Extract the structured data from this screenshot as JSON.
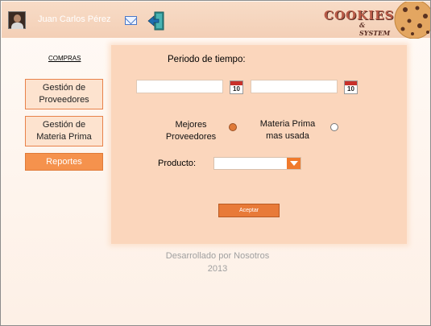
{
  "header": {
    "user_name": "Juan Carlos Pérez",
    "mail_icon": "mail-icon",
    "exit_icon": "exit-icon",
    "logo_text": "COOKIES",
    "logo_sub": "& SYSTEM"
  },
  "sidebar": {
    "section_title": "COMPRAS",
    "items": [
      {
        "label_line1": "Gestión de",
        "label_line2": "Proveedores"
      },
      {
        "label_line1": "Gestión de",
        "label_line2": "Materia Prima"
      },
      {
        "label_line1": "Reportes",
        "label_line2": ""
      }
    ],
    "active_color": "#f5924d"
  },
  "report": {
    "period_label": "Periodo de tiempo:",
    "date_from_value": "",
    "date_to_value": "",
    "calendar_day": "10",
    "option_best_line1": "Mejores",
    "option_best_line2": "Proveedores",
    "option_material_line1": "Materia Prima",
    "option_material_line2": "mas usada",
    "selected_option": "Mejores Proveedores",
    "product_label": "Producto:",
    "product_value": "",
    "accept_label": "Aceptar"
  },
  "footer": {
    "line1": "Desarrollado por Nosotros",
    "line2": "2013"
  },
  "colors": {
    "accent": "#f07a2c",
    "panel": "#fbd6bc",
    "header": "#f3cfb6"
  }
}
